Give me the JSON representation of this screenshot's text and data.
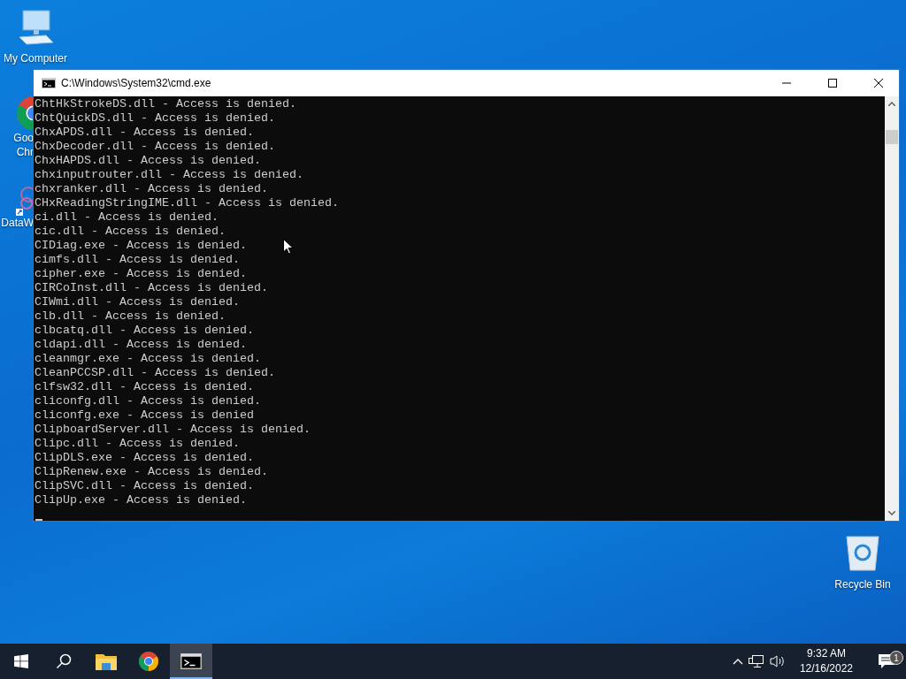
{
  "desktop_icons": [
    {
      "kind": "computer",
      "lines": [
        "My Computer"
      ]
    },
    {
      "kind": "chrome",
      "lines": [
        "Goo",
        "Chr"
      ]
    },
    {
      "kind": "app",
      "lines": [
        "DataW"
      ]
    },
    {
      "kind": "recycle",
      "lines": [
        "Recycle Bin"
      ]
    }
  ],
  "window": {
    "title": "C:\\Windows\\System32\\cmd.exe",
    "lines": [
      "ChtHkStrokeDS.dll - Access is denied.",
      "ChtQuickDS.dll - Access is denied.",
      "ChxAPDS.dll - Access is denied.",
      "ChxDecoder.dll - Access is denied.",
      "ChxHAPDS.dll - Access is denied.",
      "chxinputrouter.dll - Access is denied.",
      "chxranker.dll - Access is denied.",
      "CHxReadingStringIME.dll - Access is denied.",
      "ci.dll - Access is denied.",
      "cic.dll - Access is denied.",
      "CIDiag.exe - Access is denied.",
      "cimfs.dll - Access is denied.",
      "cipher.exe - Access is denied.",
      "CIRCoInst.dll - Access is denied.",
      "CIWmi.dll - Access is denied.",
      "clb.dll - Access is denied.",
      "clbcatq.dll - Access is denied.",
      "cldapi.dll - Access is denied.",
      "cleanmgr.exe - Access is denied.",
      "CleanPCCSP.dll - Access is denied.",
      "clfsw32.dll - Access is denied.",
      "cliconfg.dll - Access is denied.",
      "cliconfg.exe - Access is denied",
      "ClipboardServer.dll - Access is denied.",
      "Clipc.dll - Access is denied.",
      "ClipDLS.exe - Access is denied.",
      "ClipRenew.exe - Access is denied.",
      "ClipSVC.dll - Access is denied.",
      "ClipUp.exe - Access is denied."
    ]
  },
  "taskbar": {
    "apps": [
      {
        "kind": "explorer",
        "selected": false
      },
      {
        "kind": "chrome",
        "selected": false
      },
      {
        "kind": "cmd",
        "selected": true
      }
    ],
    "clock": {
      "time": "9:32 AM",
      "date": "12/16/2022"
    },
    "notifications": {
      "badge": "1"
    }
  }
}
